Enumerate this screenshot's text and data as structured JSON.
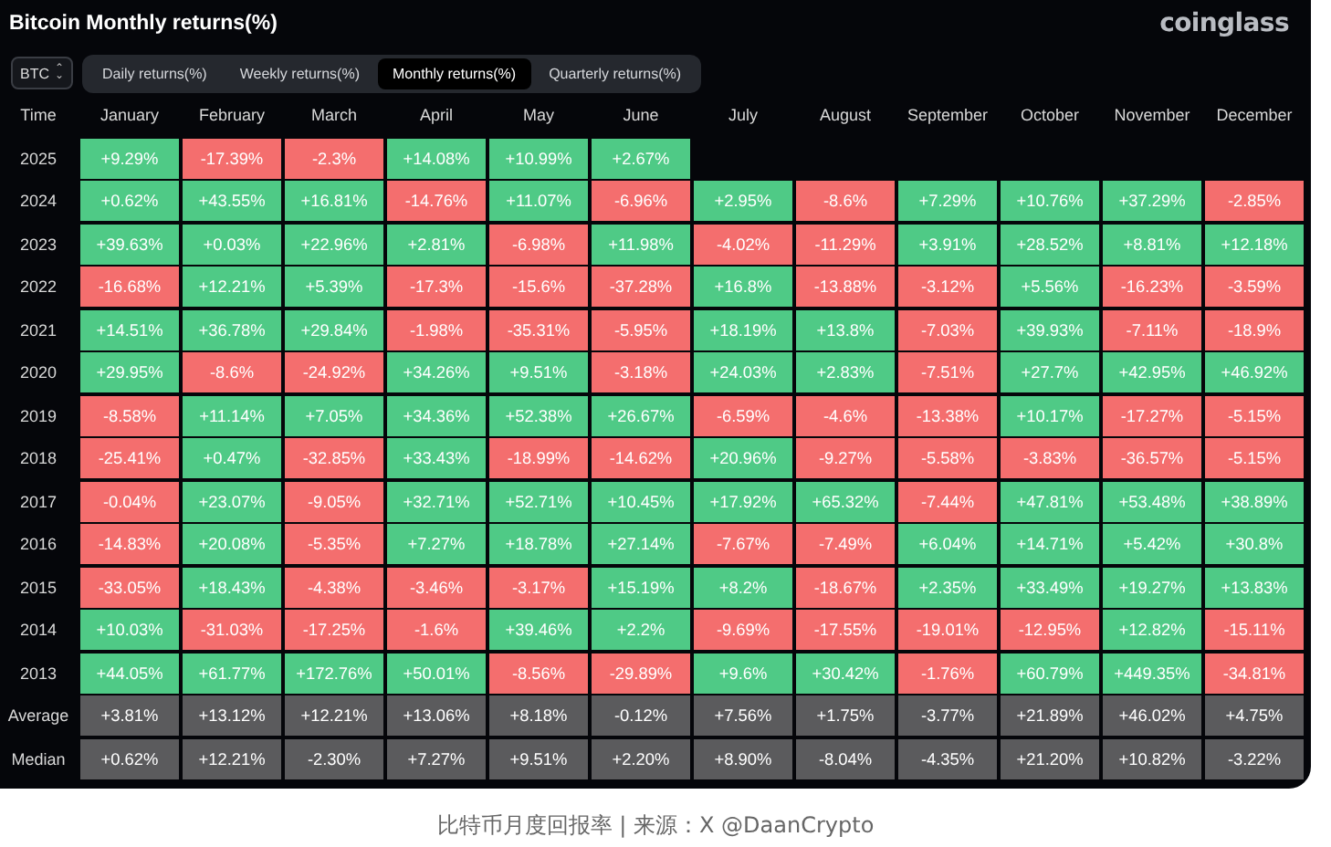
{
  "title": "Bitcoin Monthly returns(%)",
  "logo": "coinglass",
  "asset_select": {
    "value": "BTC",
    "icon": "⌃⌄"
  },
  "tabs": [
    {
      "label": "Daily returns(%)",
      "selected": false
    },
    {
      "label": "Weekly returns(%)",
      "selected": false
    },
    {
      "label": "Monthly returns(%)",
      "selected": true
    },
    {
      "label": "Quarterly returns(%)",
      "selected": false
    }
  ],
  "table": {
    "row_header": "Time",
    "columns": [
      "January",
      "February",
      "March",
      "April",
      "May",
      "June",
      "July",
      "August",
      "September",
      "October",
      "November",
      "December"
    ],
    "rows": [
      {
        "label": "2025",
        "kind": "year",
        "cells": [
          {
            "value": "+9.29%",
            "color": "#4fca86"
          },
          {
            "value": "-17.39%",
            "color": "#f46e6e"
          },
          {
            "value": "-2.3%",
            "color": "#f46e6e"
          },
          {
            "value": "+14.08%",
            "color": "#4fca86"
          },
          {
            "value": "+10.99%",
            "color": "#4fca86"
          },
          {
            "value": "+2.67%",
            "color": "#4fca86"
          }
        ]
      },
      {
        "label": "2024",
        "kind": "year",
        "cells": [
          {
            "value": "+0.62%",
            "color": "#4fca86"
          },
          {
            "value": "+43.55%",
            "color": "#4fca86"
          },
          {
            "value": "+16.81%",
            "color": "#4fca86"
          },
          {
            "value": "-14.76%",
            "color": "#f46e6e"
          },
          {
            "value": "+11.07%",
            "color": "#4fca86"
          },
          {
            "value": "-6.96%",
            "color": "#f46e6e"
          },
          {
            "value": "+2.95%",
            "color": "#4fca86"
          },
          {
            "value": "-8.6%",
            "color": "#f46e6e"
          },
          {
            "value": "+7.29%",
            "color": "#4fca86"
          },
          {
            "value": "+10.76%",
            "color": "#4fca86"
          },
          {
            "value": "+37.29%",
            "color": "#4fca86"
          },
          {
            "value": "-2.85%",
            "color": "#f46e6e"
          }
        ]
      },
      {
        "label": "2023",
        "kind": "year",
        "cells": [
          {
            "value": "+39.63%",
            "color": "#4fca86"
          },
          {
            "value": "+0.03%",
            "color": "#4fca86"
          },
          {
            "value": "+22.96%",
            "color": "#4fca86"
          },
          {
            "value": "+2.81%",
            "color": "#4fca86"
          },
          {
            "value": "-6.98%",
            "color": "#f46e6e"
          },
          {
            "value": "+11.98%",
            "color": "#4fca86"
          },
          {
            "value": "-4.02%",
            "color": "#f46e6e"
          },
          {
            "value": "-11.29%",
            "color": "#f46e6e"
          },
          {
            "value": "+3.91%",
            "color": "#4fca86"
          },
          {
            "value": "+28.52%",
            "color": "#4fca86"
          },
          {
            "value": "+8.81%",
            "color": "#4fca86"
          },
          {
            "value": "+12.18%",
            "color": "#4fca86"
          }
        ]
      },
      {
        "label": "2022",
        "kind": "year",
        "cells": [
          {
            "value": "-16.68%",
            "color": "#f46e6e"
          },
          {
            "value": "+12.21%",
            "color": "#4fca86"
          },
          {
            "value": "+5.39%",
            "color": "#4fca86"
          },
          {
            "value": "-17.3%",
            "color": "#f46e6e"
          },
          {
            "value": "-15.6%",
            "color": "#f46e6e"
          },
          {
            "value": "-37.28%",
            "color": "#f46e6e"
          },
          {
            "value": "+16.8%",
            "color": "#4fca86"
          },
          {
            "value": "-13.88%",
            "color": "#f46e6e"
          },
          {
            "value": "-3.12%",
            "color": "#f46e6e"
          },
          {
            "value": "+5.56%",
            "color": "#4fca86"
          },
          {
            "value": "-16.23%",
            "color": "#f46e6e"
          },
          {
            "value": "-3.59%",
            "color": "#f46e6e"
          }
        ]
      },
      {
        "label": "2021",
        "kind": "year",
        "cells": [
          {
            "value": "+14.51%",
            "color": "#4fca86"
          },
          {
            "value": "+36.78%",
            "color": "#4fca86"
          },
          {
            "value": "+29.84%",
            "color": "#4fca86"
          },
          {
            "value": "-1.98%",
            "color": "#f46e6e"
          },
          {
            "value": "-35.31%",
            "color": "#f46e6e"
          },
          {
            "value": "-5.95%",
            "color": "#f46e6e"
          },
          {
            "value": "+18.19%",
            "color": "#4fca86"
          },
          {
            "value": "+13.8%",
            "color": "#4fca86"
          },
          {
            "value": "-7.03%",
            "color": "#f46e6e"
          },
          {
            "value": "+39.93%",
            "color": "#4fca86"
          },
          {
            "value": "-7.11%",
            "color": "#f46e6e"
          },
          {
            "value": "-18.9%",
            "color": "#f46e6e"
          }
        ]
      },
      {
        "label": "2020",
        "kind": "year",
        "cells": [
          {
            "value": "+29.95%",
            "color": "#4fca86"
          },
          {
            "value": "-8.6%",
            "color": "#f46e6e"
          },
          {
            "value": "-24.92%",
            "color": "#f46e6e"
          },
          {
            "value": "+34.26%",
            "color": "#4fca86"
          },
          {
            "value": "+9.51%",
            "color": "#4fca86"
          },
          {
            "value": "-3.18%",
            "color": "#f46e6e"
          },
          {
            "value": "+24.03%",
            "color": "#4fca86"
          },
          {
            "value": "+2.83%",
            "color": "#4fca86"
          },
          {
            "value": "-7.51%",
            "color": "#f46e6e"
          },
          {
            "value": "+27.7%",
            "color": "#4fca86"
          },
          {
            "value": "+42.95%",
            "color": "#4fca86"
          },
          {
            "value": "+46.92%",
            "color": "#4fca86"
          }
        ]
      },
      {
        "label": "2019",
        "kind": "year",
        "cells": [
          {
            "value": "-8.58%",
            "color": "#f46e6e"
          },
          {
            "value": "+11.14%",
            "color": "#4fca86"
          },
          {
            "value": "+7.05%",
            "color": "#4fca86"
          },
          {
            "value": "+34.36%",
            "color": "#4fca86"
          },
          {
            "value": "+52.38%",
            "color": "#4fca86"
          },
          {
            "value": "+26.67%",
            "color": "#4fca86"
          },
          {
            "value": "-6.59%",
            "color": "#f46e6e"
          },
          {
            "value": "-4.6%",
            "color": "#f46e6e"
          },
          {
            "value": "-13.38%",
            "color": "#f46e6e"
          },
          {
            "value": "+10.17%",
            "color": "#4fca86"
          },
          {
            "value": "-17.27%",
            "color": "#f46e6e"
          },
          {
            "value": "-5.15%",
            "color": "#f46e6e"
          }
        ]
      },
      {
        "label": "2018",
        "kind": "year",
        "cells": [
          {
            "value": "-25.41%",
            "color": "#f46e6e"
          },
          {
            "value": "+0.47%",
            "color": "#4fca86"
          },
          {
            "value": "-32.85%",
            "color": "#f46e6e"
          },
          {
            "value": "+33.43%",
            "color": "#4fca86"
          },
          {
            "value": "-18.99%",
            "color": "#f46e6e"
          },
          {
            "value": "-14.62%",
            "color": "#f46e6e"
          },
          {
            "value": "+20.96%",
            "color": "#4fca86"
          },
          {
            "value": "-9.27%",
            "color": "#f46e6e"
          },
          {
            "value": "-5.58%",
            "color": "#f46e6e"
          },
          {
            "value": "-3.83%",
            "color": "#f46e6e"
          },
          {
            "value": "-36.57%",
            "color": "#f46e6e"
          },
          {
            "value": "-5.15%",
            "color": "#f46e6e"
          }
        ]
      },
      {
        "label": "2017",
        "kind": "year",
        "cells": [
          {
            "value": "-0.04%",
            "color": "#f46e6e"
          },
          {
            "value": "+23.07%",
            "color": "#4fca86"
          },
          {
            "value": "-9.05%",
            "color": "#f46e6e"
          },
          {
            "value": "+32.71%",
            "color": "#4fca86"
          },
          {
            "value": "+52.71%",
            "color": "#4fca86"
          },
          {
            "value": "+10.45%",
            "color": "#4fca86"
          },
          {
            "value": "+17.92%",
            "color": "#4fca86"
          },
          {
            "value": "+65.32%",
            "color": "#4fca86"
          },
          {
            "value": "-7.44%",
            "color": "#f46e6e"
          },
          {
            "value": "+47.81%",
            "color": "#4fca86"
          },
          {
            "value": "+53.48%",
            "color": "#4fca86"
          },
          {
            "value": "+38.89%",
            "color": "#4fca86"
          }
        ]
      },
      {
        "label": "2016",
        "kind": "year",
        "cells": [
          {
            "value": "-14.83%",
            "color": "#f46e6e"
          },
          {
            "value": "+20.08%",
            "color": "#4fca86"
          },
          {
            "value": "-5.35%",
            "color": "#f46e6e"
          },
          {
            "value": "+7.27%",
            "color": "#4fca86"
          },
          {
            "value": "+18.78%",
            "color": "#4fca86"
          },
          {
            "value": "+27.14%",
            "color": "#4fca86"
          },
          {
            "value": "-7.67%",
            "color": "#f46e6e"
          },
          {
            "value": "-7.49%",
            "color": "#f46e6e"
          },
          {
            "value": "+6.04%",
            "color": "#4fca86"
          },
          {
            "value": "+14.71%",
            "color": "#4fca86"
          },
          {
            "value": "+5.42%",
            "color": "#4fca86"
          },
          {
            "value": "+30.8%",
            "color": "#4fca86"
          }
        ]
      },
      {
        "label": "2015",
        "kind": "year",
        "cells": [
          {
            "value": "-33.05%",
            "color": "#f46e6e"
          },
          {
            "value": "+18.43%",
            "color": "#4fca86"
          },
          {
            "value": "-4.38%",
            "color": "#f46e6e"
          },
          {
            "value": "-3.46%",
            "color": "#f46e6e"
          },
          {
            "value": "-3.17%",
            "color": "#f46e6e"
          },
          {
            "value": "+15.19%",
            "color": "#4fca86"
          },
          {
            "value": "+8.2%",
            "color": "#4fca86"
          },
          {
            "value": "-18.67%",
            "color": "#f46e6e"
          },
          {
            "value": "+2.35%",
            "color": "#4fca86"
          },
          {
            "value": "+33.49%",
            "color": "#4fca86"
          },
          {
            "value": "+19.27%",
            "color": "#4fca86"
          },
          {
            "value": "+13.83%",
            "color": "#4fca86"
          }
        ]
      },
      {
        "label": "2014",
        "kind": "year",
        "cells": [
          {
            "value": "+10.03%",
            "color": "#4fca86"
          },
          {
            "value": "-31.03%",
            "color": "#f46e6e"
          },
          {
            "value": "-17.25%",
            "color": "#f46e6e"
          },
          {
            "value": "-1.6%",
            "color": "#f46e6e"
          },
          {
            "value": "+39.46%",
            "color": "#4fca86"
          },
          {
            "value": "+2.2%",
            "color": "#4fca86"
          },
          {
            "value": "-9.69%",
            "color": "#f46e6e"
          },
          {
            "value": "-17.55%",
            "color": "#f46e6e"
          },
          {
            "value": "-19.01%",
            "color": "#f46e6e"
          },
          {
            "value": "-12.95%",
            "color": "#f46e6e"
          },
          {
            "value": "+12.82%",
            "color": "#4fca86"
          },
          {
            "value": "-15.11%",
            "color": "#f46e6e"
          }
        ]
      },
      {
        "label": "2013",
        "kind": "year",
        "cells": [
          {
            "value": "+44.05%",
            "color": "#4fca86"
          },
          {
            "value": "+61.77%",
            "color": "#4fca86"
          },
          {
            "value": "+172.76%",
            "color": "#4fca86"
          },
          {
            "value": "+50.01%",
            "color": "#4fca86"
          },
          {
            "value": "-8.56%",
            "color": "#f46e6e"
          },
          {
            "value": "-29.89%",
            "color": "#f46e6e"
          },
          {
            "value": "+9.6%",
            "color": "#4fca86"
          },
          {
            "value": "+30.42%",
            "color": "#4fca86"
          },
          {
            "value": "-1.76%",
            "color": "#f46e6e"
          },
          {
            "value": "+60.79%",
            "color": "#4fca86"
          },
          {
            "value": "+449.35%",
            "color": "#4fca86"
          },
          {
            "value": "-34.81%",
            "color": "#f46e6e"
          }
        ]
      },
      {
        "label": "Average",
        "kind": "summary",
        "cells": [
          {
            "value": "+3.81%"
          },
          {
            "value": "+13.12%"
          },
          {
            "value": "+12.21%"
          },
          {
            "value": "+13.06%"
          },
          {
            "value": "+8.18%"
          },
          {
            "value": "-0.12%"
          },
          {
            "value": "+7.56%"
          },
          {
            "value": "+1.75%"
          },
          {
            "value": "-3.77%"
          },
          {
            "value": "+21.89%"
          },
          {
            "value": "+46.02%"
          },
          {
            "value": "+4.75%"
          }
        ]
      },
      {
        "label": "Median",
        "kind": "summary",
        "cells": [
          {
            "value": "+0.62%"
          },
          {
            "value": "+12.21%"
          },
          {
            "value": "-2.30%"
          },
          {
            "value": "+7.27%"
          },
          {
            "value": "+9.51%"
          },
          {
            "value": "+2.20%"
          },
          {
            "value": "+8.90%"
          },
          {
            "value": "-8.04%"
          },
          {
            "value": "-4.35%"
          },
          {
            "value": "+21.20%"
          },
          {
            "value": "+10.82%"
          },
          {
            "value": "-3.22%"
          }
        ]
      }
    ]
  },
  "caption": "比特币月度回报率 | 来源：X @DaanCrypto"
}
